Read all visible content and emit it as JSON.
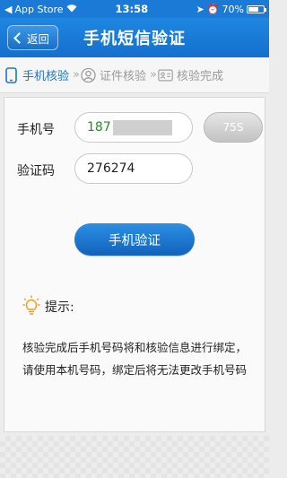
{
  "status_bar": {
    "carrier": "App Store",
    "time": "13:58",
    "battery": "70%",
    "battery_level": 0.7
  },
  "nav": {
    "back_label": "返回",
    "title": "手机短信验证"
  },
  "steps": [
    {
      "label": "手机核验",
      "active": true,
      "icon": "phone-icon"
    },
    {
      "label": "证件核验",
      "active": false,
      "icon": "person-icon"
    },
    {
      "label": "核验完成",
      "active": false,
      "icon": "id-card-icon"
    }
  ],
  "step_separator": "»",
  "form": {
    "phone_label": "手机号",
    "phone_value_visible": "187",
    "countdown_label": "75S",
    "code_label": "验证码",
    "code_value": "276274",
    "verify_button": "手机验证"
  },
  "tip": {
    "title": "提示:",
    "text": "核验完成后手机号码将和核验信息进行绑定，请使用本机号码，绑定后将无法更改手机号码"
  },
  "colors": {
    "accent": "#1a74cf",
    "phone_text": "#2a8a2a"
  }
}
